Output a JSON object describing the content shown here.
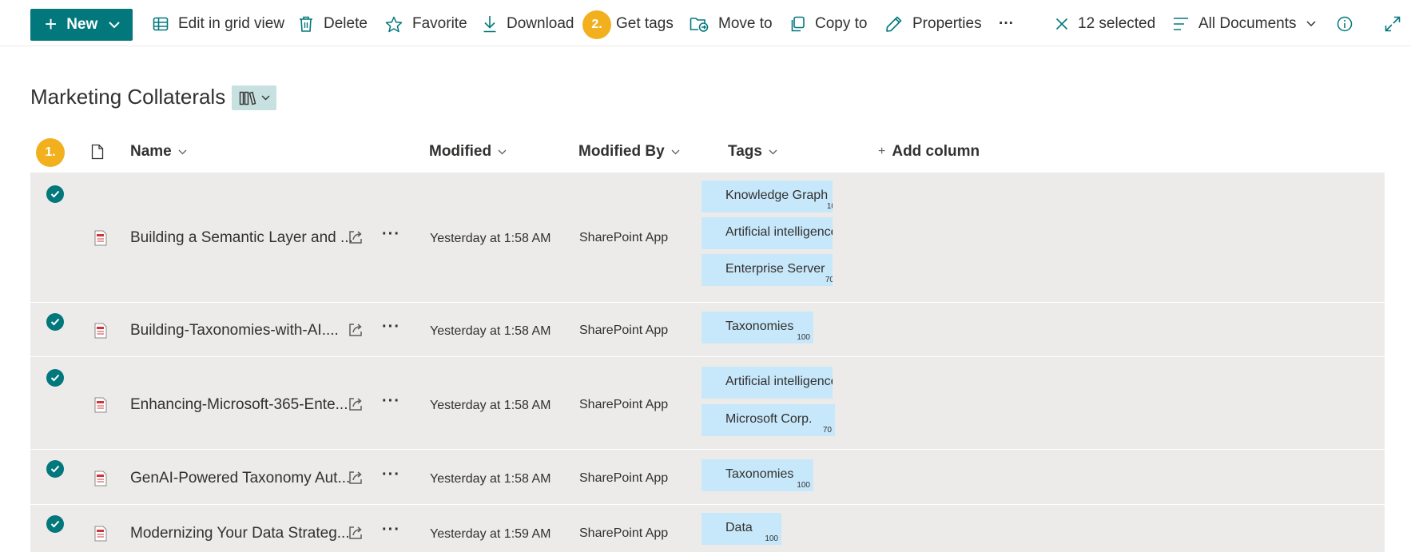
{
  "toolbar": {
    "new_label": "New",
    "edit_grid_label": "Edit in grid view",
    "delete_label": "Delete",
    "favorite_label": "Favorite",
    "download_label": "Download",
    "get_tags_badge": "2.",
    "get_tags_label": "Get tags",
    "move_to_label": "Move to",
    "copy_to_label": "Copy to",
    "properties_label": "Properties",
    "more_label": "···",
    "selected_label": "12 selected",
    "view_label": "All Documents"
  },
  "page": {
    "title": "Marketing Collaterals"
  },
  "columns": {
    "select_badge": "1.",
    "name": "Name",
    "modified": "Modified",
    "modified_by": "Modified By",
    "tags": "Tags",
    "add_column": "Add column"
  },
  "rows": [
    {
      "name": "Building a Semantic Layer and ...",
      "modified": "Yesterday at 1:58 AM",
      "modified_by": "SharePoint App",
      "tags": [
        {
          "label": "Knowledge Graph",
          "score": "10"
        },
        {
          "label": "Artificial intelligence",
          "score": ""
        },
        {
          "label": "Enterprise Server",
          "score": "70"
        }
      ]
    },
    {
      "name": "Building-Taxonomies-with-AI....",
      "modified": "Yesterday at 1:58 AM",
      "modified_by": "SharePoint App",
      "tags": [
        {
          "label": "Taxonomies",
          "score": "100"
        }
      ]
    },
    {
      "name": "Enhancing-Microsoft-365-Ente...",
      "modified": "Yesterday at 1:58 AM",
      "modified_by": "SharePoint App",
      "tags": [
        {
          "label": "Artificial intelligence",
          "score": ""
        },
        {
          "label": "Microsoft Corp.",
          "score": "70"
        }
      ]
    },
    {
      "name": "GenAI-Powered Taxonomy Aut...",
      "modified": "Yesterday at 1:58 AM",
      "modified_by": "SharePoint App",
      "tags": [
        {
          "label": "Taxonomies",
          "score": "100"
        }
      ]
    },
    {
      "name": "Modernizing Your Data Strateg...",
      "modified": "Yesterday at 1:59 AM",
      "modified_by": "SharePoint App",
      "tags": [
        {
          "label": "Data",
          "score": "100"
        }
      ]
    }
  ],
  "colors": {
    "accent": "#03787c",
    "badge": "#f2b01e",
    "row_selected": "#edebe9",
    "tag_bg": "#c7e8fa",
    "view_chip_bg": "#c7e0e0"
  },
  "icons": {
    "new": "plus-icon",
    "grid": "grid-icon",
    "delete": "trash-icon",
    "favorite": "star-icon",
    "download": "download-icon",
    "move": "folder-move-icon",
    "copy": "copy-icon",
    "properties": "pencil-icon",
    "close": "close-icon",
    "view": "list-icon",
    "info": "info-icon",
    "expand": "expand-icon",
    "file": "pdf-file-icon",
    "share": "share-icon",
    "check": "checkmark-icon"
  }
}
